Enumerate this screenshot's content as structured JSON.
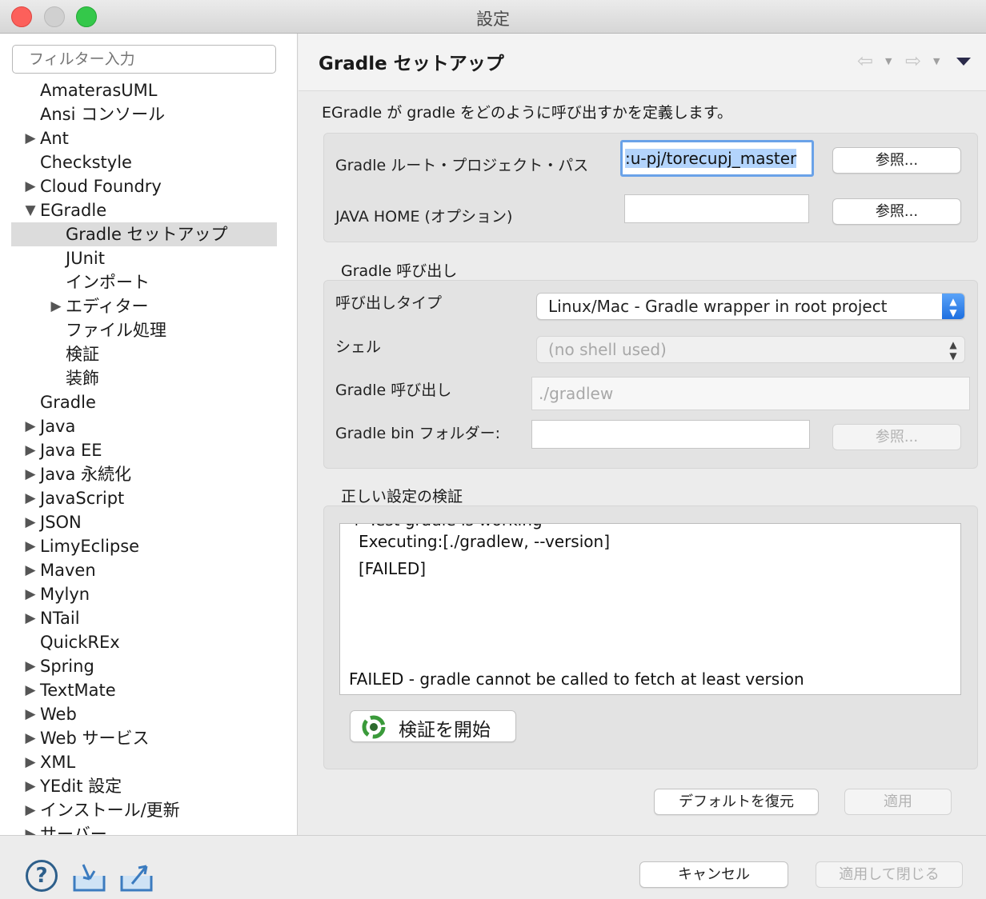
{
  "window": {
    "title": "設定"
  },
  "sidebar": {
    "filter_placeholder": "フィルター入力",
    "items": [
      {
        "label": "AmaterasUML",
        "expander": ""
      },
      {
        "label": "Ansi コンソール",
        "expander": ""
      },
      {
        "label": "Ant",
        "expander": "▶"
      },
      {
        "label": "Checkstyle",
        "expander": ""
      },
      {
        "label": "Cloud Foundry",
        "expander": "▶"
      },
      {
        "label": "EGradle",
        "expander": "▼"
      },
      {
        "label": "Gradle セットアップ",
        "expander": ""
      },
      {
        "label": "JUnit",
        "expander": ""
      },
      {
        "label": "インポート",
        "expander": ""
      },
      {
        "label": "エディター",
        "expander": "▶"
      },
      {
        "label": "ファイル処理",
        "expander": ""
      },
      {
        "label": "検証",
        "expander": ""
      },
      {
        "label": "装飾",
        "expander": ""
      },
      {
        "label": "Gradle",
        "expander": ""
      },
      {
        "label": "Java",
        "expander": "▶"
      },
      {
        "label": "Java EE",
        "expander": "▶"
      },
      {
        "label": "Java 永続化",
        "expander": "▶"
      },
      {
        "label": "JavaScript",
        "expander": "▶"
      },
      {
        "label": "JSON",
        "expander": "▶"
      },
      {
        "label": "LimyEclipse",
        "expander": "▶"
      },
      {
        "label": "Maven",
        "expander": "▶"
      },
      {
        "label": "Mylyn",
        "expander": "▶"
      },
      {
        "label": "NTail",
        "expander": "▶"
      },
      {
        "label": "QuickREx",
        "expander": ""
      },
      {
        "label": "Spring",
        "expander": "▶"
      },
      {
        "label": "TextMate",
        "expander": "▶"
      },
      {
        "label": "Web",
        "expander": "▶"
      },
      {
        "label": "Web サービス",
        "expander": "▶"
      },
      {
        "label": "XML",
        "expander": "▶"
      },
      {
        "label": "YEdit 設定",
        "expander": "▶"
      },
      {
        "label": "インストール/更新",
        "expander": "▶"
      },
      {
        "label": "サーバー",
        "expander": "▶"
      }
    ]
  },
  "header": {
    "title": "Gradle セットアップ",
    "back_icon": "⇦",
    "forward_icon": "⇨",
    "caret": "▼"
  },
  "description": "EGradle が gradle をどのように呼び出すかを定義します。",
  "paths": {
    "root_label": "Gradle ルート・プロジェクト・パス",
    "root_value": ":u-pj/torecupj_master",
    "java_home_label": "JAVA HOME (オプション)",
    "java_home_value": "",
    "browse": "参照..."
  },
  "invocation": {
    "section": "Gradle 呼び出し",
    "type_label": "呼び出しタイプ",
    "type_value": "Linux/Mac - Gradle wrapper in root project",
    "shell_label": "シェル",
    "shell_value": "(no shell used)",
    "call_label": "Gradle 呼び出し",
    "call_value": "./gradlew",
    "bin_label": "Gradle bin フォルダー:",
    "bin_value": "",
    "browse": "参照..."
  },
  "verification": {
    "section": "正しい設定の検証",
    "log_partial": "+ Test gradle is working",
    "log_exec": "Executing:[./gradlew, --version]",
    "log_failed": "[FAILED]",
    "log_result": "FAILED - gradle cannot be called to fetch at least version",
    "start_button": "検証を開始"
  },
  "actions": {
    "restore_defaults": "デフォルトを復元",
    "apply": "適用",
    "cancel": "キャンセル",
    "apply_close": "適用して閉じる"
  },
  "footer": {
    "help_icon": "?"
  },
  "colors": {
    "accent": "#1e6fe0",
    "selection": "#b3d4fc",
    "focus_ring": "#6aa2e8"
  }
}
